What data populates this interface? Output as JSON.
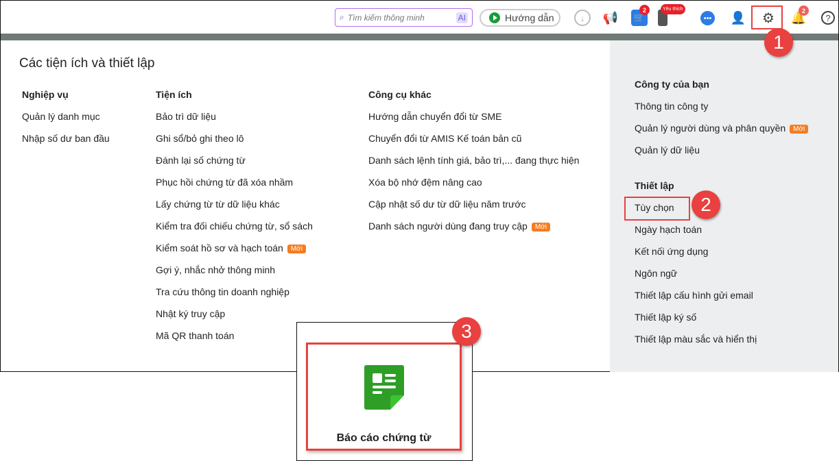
{
  "topbar": {
    "search_placeholder": "Tìm kiếm thông minh",
    "ai_label": "AI",
    "guide_label": "Hướng dẫn",
    "cart_badge": "2",
    "favorite_badge": "Yêu thích",
    "notification_badge": "2"
  },
  "panel": {
    "title": "Các tiện ích và thiết lập",
    "nghiep_vu": {
      "heading": "Nghiệp vụ",
      "items": [
        "Quản lý danh mục",
        "Nhập số dư ban đầu"
      ]
    },
    "tien_ich": {
      "heading": "Tiện ích",
      "items": [
        "Bảo trì dữ liệu",
        "Ghi sổ/bỏ ghi theo lô",
        "Đánh lại số chứng từ",
        "Phục hồi chứng từ đã xóa nhầm",
        "Lấy chứng từ từ dữ liệu khác",
        "Kiểm tra đối chiếu chứng từ, sổ sách",
        "Kiểm soát hồ sơ và hạch toán",
        "Gợi ý, nhắc nhở thông minh",
        "Tra cứu thông tin doanh nghiệp",
        "Nhật ký truy cập",
        "Mã QR thanh toán"
      ]
    },
    "cong_cu": {
      "heading": "Công cụ khác",
      "items": [
        "Hướng dẫn chuyển đổi từ SME",
        "Chuyển đổi từ AMIS Kế toán bản cũ",
        "Danh sách lệnh tính giá, bảo trì,... đang thực hiện",
        "Xóa bộ nhớ đệm nâng cao",
        "Cập nhật số dư từ dữ liệu năm trước",
        "Danh sách người dùng đang truy cập"
      ]
    },
    "cong_ty": {
      "heading": "Công ty của bạn",
      "items": [
        "Thông tin công ty",
        "Quản lý người dùng và phân quyền",
        "Quản lý dữ liệu"
      ]
    },
    "thiet_lap": {
      "heading": "Thiết lập",
      "items": [
        "Tùy chọn",
        "Ngày hạch toán",
        "Kết nối ứng dụng",
        "Ngôn ngữ",
        "Thiết lập cấu hình gửi email",
        "Thiết lập ký số",
        "Thiết lập màu sắc và hiển thị"
      ]
    },
    "new_label": "Mới"
  },
  "callout": {
    "label": "Báo cáo chứng từ"
  },
  "steps": [
    "1",
    "2",
    "3"
  ]
}
